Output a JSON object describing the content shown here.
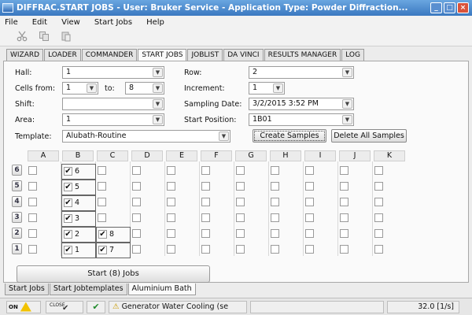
{
  "window": {
    "title": "DIFFRAC.START JOBS - User: Bruker Service - Application Type: Powder Diffraction...",
    "min": "_",
    "max": "□",
    "close": "×"
  },
  "menu": [
    "File",
    "Edit",
    "View",
    "Start Jobs",
    "Help"
  ],
  "toolbar": {
    "icons": [
      "scissors-icon",
      "copy-icon",
      "paste-icon"
    ]
  },
  "tabs": [
    "WIZARD",
    "LOADER",
    "COMMANDER",
    "START JOBS",
    "JOBLIST",
    "DA VINCI",
    "RESULTS MANAGER",
    "LOG"
  ],
  "active_tab": "START JOBS",
  "form": {
    "hall_label": "Hall:",
    "hall_value": "1",
    "row_label": "Row:",
    "row_value": "2",
    "cells_from_label": "Cells from:",
    "cells_from_value": "1",
    "to_label": "to:",
    "to_value": "8",
    "increment_label": "Increment:",
    "increment_value": "1",
    "shift_label": "Shift:",
    "shift_value": "",
    "sampling_date_label": "Sampling Date:",
    "sampling_date_value": "3/2/2015 3:52 PM",
    "area_label": "Area:",
    "area_value": "1",
    "start_position_label": "Start Position:",
    "start_position_value": "1B01",
    "template_label": "Template:",
    "template_value": "Alubath-Routine",
    "create_samples": "Create Samples",
    "delete_all_samples": "Delete All Samples"
  },
  "grid": {
    "columns": [
      "A",
      "B",
      "C",
      "D",
      "E",
      "F",
      "G",
      "H",
      "I",
      "J",
      "K"
    ],
    "rows": [
      "6",
      "5",
      "4",
      "3",
      "2",
      "1"
    ],
    "checked": [
      {
        "row": "6",
        "col": "B",
        "num": "6"
      },
      {
        "row": "5",
        "col": "B",
        "num": "5"
      },
      {
        "row": "4",
        "col": "B",
        "num": "4"
      },
      {
        "row": "3",
        "col": "B",
        "num": "3"
      },
      {
        "row": "2",
        "col": "B",
        "num": "2"
      },
      {
        "row": "2",
        "col": "C",
        "num": "8"
      },
      {
        "row": "1",
        "col": "B",
        "num": "1"
      },
      {
        "row": "1",
        "col": "C",
        "num": "7"
      }
    ]
  },
  "start_button": "Start (8) Jobs",
  "bottom_tabs": [
    "Start Jobs",
    "Start Jobtemplates",
    "Aluminium Bath"
  ],
  "bottom_active": "Aluminium Bath",
  "status": {
    "on_label": "ON",
    "close_label": "CLOSE",
    "message": "Generator Water Cooling (se",
    "rate": "32.0 [1/s]"
  }
}
